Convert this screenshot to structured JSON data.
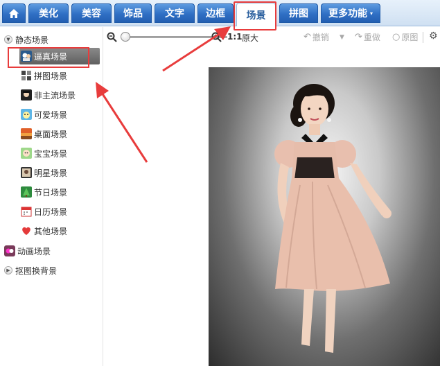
{
  "tabs": {
    "home_icon": "home-icon",
    "items": [
      {
        "label": "美化"
      },
      {
        "label": "美容"
      },
      {
        "label": "饰品"
      },
      {
        "label": "文字"
      },
      {
        "label": "边框"
      },
      {
        "label": "场景"
      },
      {
        "label": "拼图"
      },
      {
        "label": "更多功能"
      }
    ],
    "active_index": 5,
    "more_caret": "▾"
  },
  "sidebar": {
    "groups": [
      {
        "label": "静态场景",
        "expanded": true,
        "children": [
          {
            "label": "逼真场景",
            "icon": "realistic-scene-icon",
            "selected": true
          },
          {
            "label": "拼图场景",
            "icon": "collage-scene-icon"
          },
          {
            "label": "非主流场景",
            "icon": "alternative-scene-icon"
          },
          {
            "label": "可爱场景",
            "icon": "cute-scene-icon"
          },
          {
            "label": "桌面场景",
            "icon": "desktop-scene-icon"
          },
          {
            "label": "宝宝场景",
            "icon": "baby-scene-icon"
          },
          {
            "label": "明星场景",
            "icon": "star-scene-icon"
          },
          {
            "label": "节日场景",
            "icon": "holiday-scene-icon"
          },
          {
            "label": "日历场景",
            "icon": "calendar-scene-icon"
          },
          {
            "label": "其他场景",
            "icon": "heart-scene-icon"
          }
        ]
      },
      {
        "label": "动画场景",
        "icon": "animation-scene-icon"
      },
      {
        "label": "抠图换背景",
        "expanded": false
      }
    ]
  },
  "toolbar": {
    "zoom_ratio": "1:1",
    "original_size": "原大",
    "undo": "撤销",
    "redo": "重做",
    "original": "原图"
  },
  "colors": {
    "tab_blue": "#2f6fc4",
    "highlight_red": "#e83c3c",
    "selected_gray": "#6f6f6f"
  }
}
